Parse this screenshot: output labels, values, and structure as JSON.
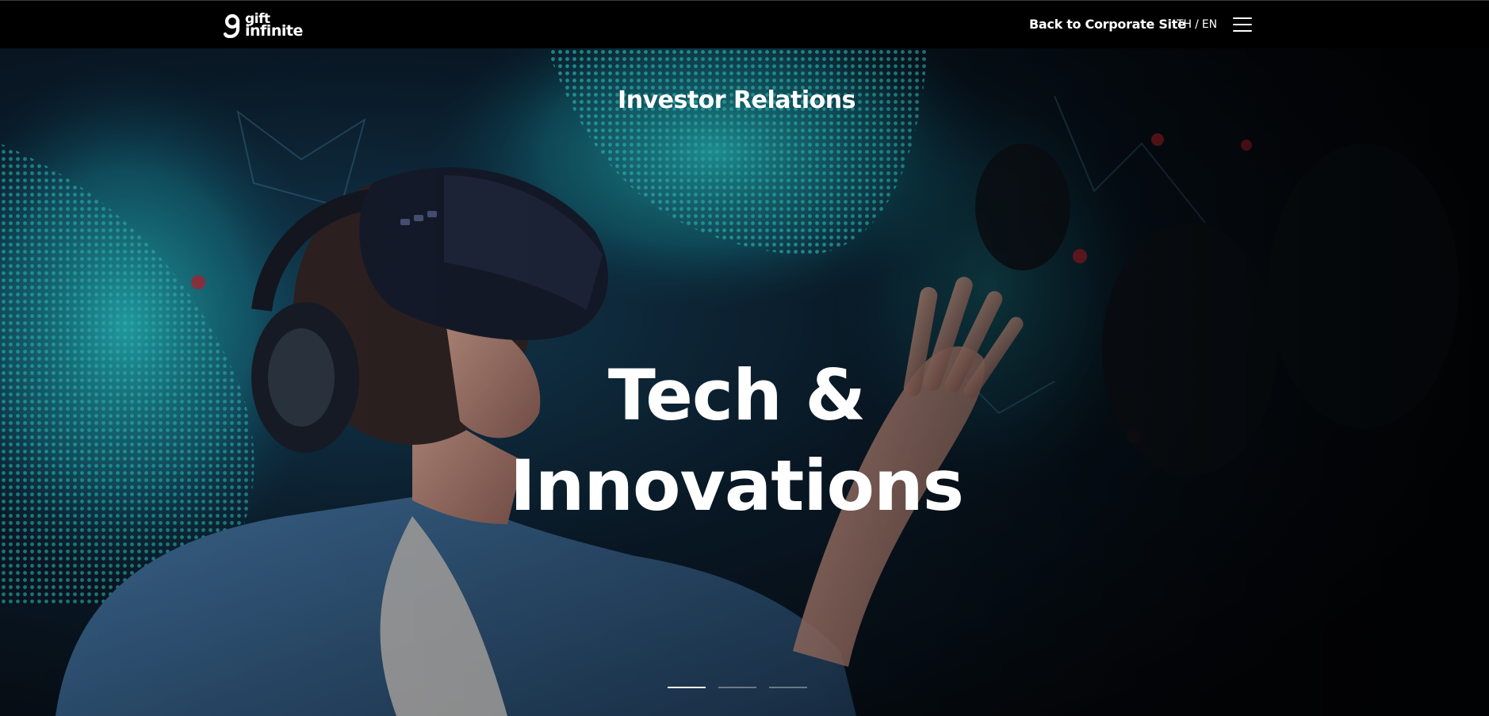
{
  "header": {
    "logo": {
      "mark": "g",
      "word_1": "gift",
      "word_2": "infinite"
    },
    "back_link_label": "Back to Corporate Site",
    "language": {
      "th": "TH",
      "separator": "/",
      "en": "EN"
    },
    "menu_icon": "hamburger-menu-icon"
  },
  "hero": {
    "eyebrow": "Investor Relations",
    "title_line_1": "Tech &",
    "title_line_2": "Innovations",
    "background_image": "person wearing a VR headset and headphones amid glowing teal holographic dots",
    "slides_count": 3,
    "active_slide": 1
  },
  "colors": {
    "topbar_background": "#000000",
    "text": "#ffffff",
    "hologram_teal": "#2bd3d6",
    "accent_red": "#e02a3a"
  }
}
